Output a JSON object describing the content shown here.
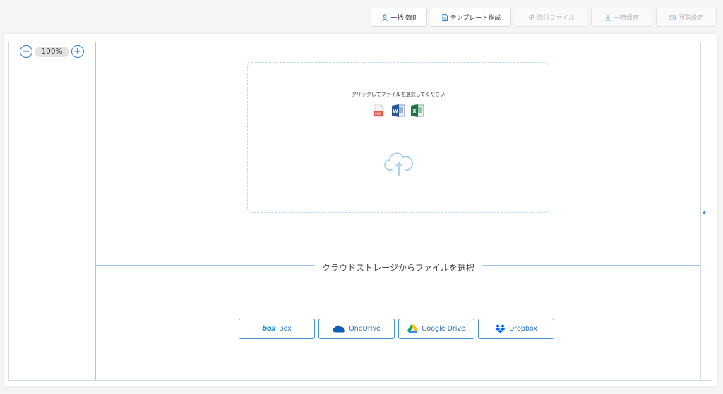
{
  "toolbar": {
    "bulk_print": "一括捺印",
    "create_template": "テンプレート作成",
    "attach_file": "添付ファイル",
    "temp_save": "一時保存",
    "response_settings": "回覧設定"
  },
  "zoom": {
    "value": "100%",
    "minus": "−",
    "plus": "+"
  },
  "dropzone": {
    "instruction": "クリックしてファイルを選択してください",
    "file_types": [
      "pdf-icon",
      "word-icon",
      "excel-icon"
    ]
  },
  "cloud": {
    "divider_label": "クラウドストレージからファイルを選択",
    "box_logo": "box",
    "box": "Box",
    "onedrive": "OneDrive",
    "google_drive": "Google Drive",
    "dropbox": "Dropbox"
  },
  "sidebar_toggle": "‹",
  "colors": {
    "accent": "#2a7bd8",
    "dropzone_border": "#b7d7f3",
    "pdf": "#e2574c",
    "word": "#2b5797",
    "excel": "#1e7145"
  }
}
